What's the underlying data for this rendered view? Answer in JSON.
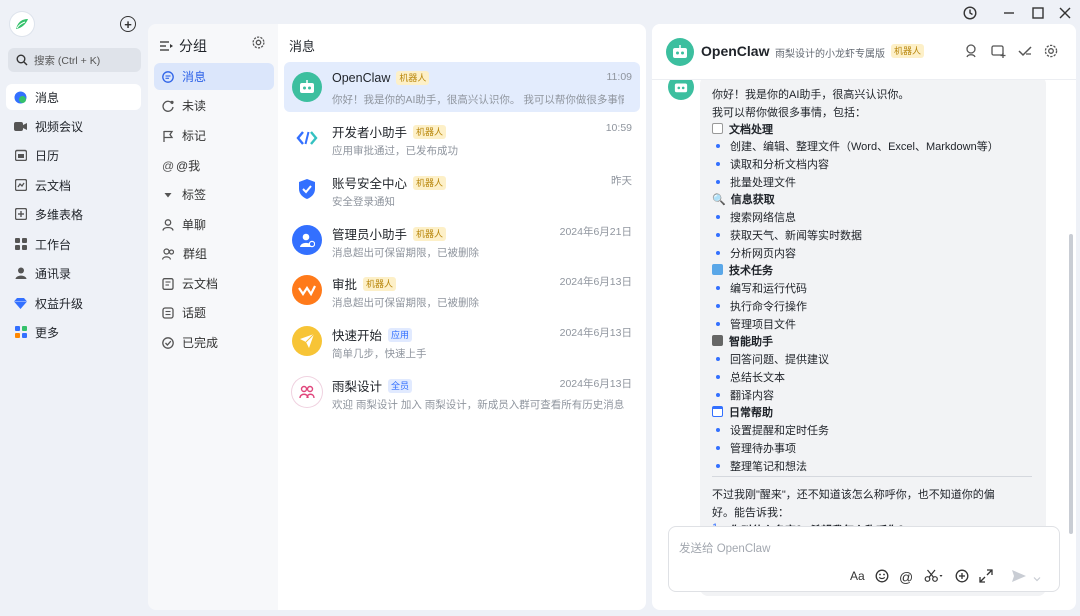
{
  "window": {
    "history_icon": "history-icon",
    "minimize_icon": "minimize-icon",
    "maximize_icon": "maximize-icon",
    "close_icon": "close-icon"
  },
  "nav": {
    "search_placeholder": "搜索 (Ctrl + K)",
    "items": [
      {
        "label": "消息",
        "icon": "message-icon"
      },
      {
        "label": "视频会议",
        "icon": "video-icon"
      },
      {
        "label": "日历",
        "icon": "calendar-icon"
      },
      {
        "label": "云文档",
        "icon": "doc-icon"
      },
      {
        "label": "多维表格",
        "icon": "table-icon"
      },
      {
        "label": "工作台",
        "icon": "apps-icon"
      },
      {
        "label": "通讯录",
        "icon": "contacts-icon"
      },
      {
        "label": "权益升级",
        "icon": "diamond-icon"
      },
      {
        "label": "更多",
        "icon": "more-icon"
      }
    ]
  },
  "groups": {
    "title": "分组",
    "items": [
      "消息",
      "未读",
      "标记",
      "@我",
      "标签",
      "单聊",
      "群组",
      "云文档",
      "话题",
      "已完成"
    ]
  },
  "messages": {
    "title": "消息",
    "rows": [
      {
        "name": "OpenClaw",
        "tag": "机器人",
        "time": "11:09",
        "snippet": "你好！我是你的AI助手，很高兴认识你。 我可以帮你做很多事情，..."
      },
      {
        "name": "开发者小助手",
        "tag": "机器人",
        "time": "10:59",
        "snippet": "应用审批通过，已发布成功"
      },
      {
        "name": "账号安全中心",
        "tag": "机器人",
        "time": "昨天",
        "snippet": "安全登录通知"
      },
      {
        "name": "管理员小助手",
        "tag": "机器人",
        "time": "2024年6月21日",
        "snippet": "消息超出可保留期限，已被删除"
      },
      {
        "name": "审批",
        "tag": "机器人",
        "time": "2024年6月13日",
        "snippet": "消息超出可保留期限，已被删除"
      },
      {
        "name": "快速开始",
        "tag": "应用",
        "time": "2024年6月13日",
        "snippet": "简单几步，快速上手"
      },
      {
        "name": "雨梨设计",
        "tag": "全员",
        "time": "2024年6月13日",
        "snippet": "欢迎 雨梨设计 加入 雨梨设计，新成员入群可查看所有历史消息"
      }
    ]
  },
  "chat": {
    "name": "OpenClaw",
    "subtitle": "雨梨设计的小龙虾专属版",
    "tag": "机器人",
    "lines": [
      "你好！我是你的AI助手，很高兴认识你。",
      "我可以帮你做很多事情，包括：",
      "文档处理",
      "创建、编辑、整理文件（Word、Excel、Markdown等）",
      "读取和分析文档内容",
      "批量处理文件",
      "信息获取",
      "搜索网络信息",
      "获取天气、新闻等实时数据",
      "分析网页内容",
      "技术任务",
      "编写和运行代码",
      "执行命令行操作",
      "管理项目文件",
      "智能助手",
      "回答问题、提供建议",
      "总结长文本",
      "翻译内容",
      "日常帮助",
      "设置提醒和定时任务",
      "管理待办事项",
      "整理笔记和想法",
      "不过我刚\"醒来\"，还不知道该怎么称呼你，也不知道你的偏",
      "好。能告诉我：",
      "你叫什么名字？ 希望我怎么称呼你？"
    ],
    "input_placeholder": "发送给 OpenClaw"
  }
}
